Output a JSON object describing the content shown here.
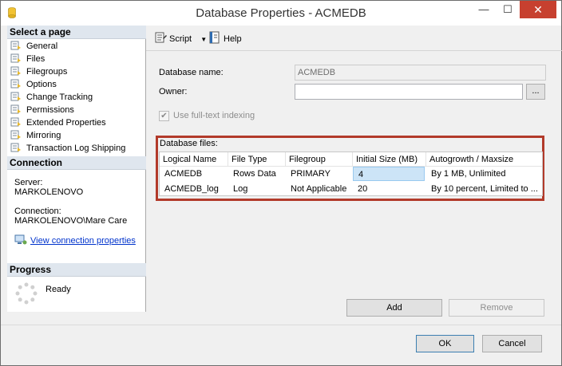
{
  "window": {
    "title": "Database Properties - ACMEDB",
    "minimize": "—",
    "maximize": "☐",
    "close": "✕"
  },
  "select_page": {
    "header": "Select a page",
    "items": [
      {
        "label": "General",
        "icon": "page-icon"
      },
      {
        "label": "Files",
        "icon": "page-icon"
      },
      {
        "label": "Filegroups",
        "icon": "page-icon"
      },
      {
        "label": "Options",
        "icon": "page-icon"
      },
      {
        "label": "Change Tracking",
        "icon": "page-icon"
      },
      {
        "label": "Permissions",
        "icon": "page-icon"
      },
      {
        "label": "Extended Properties",
        "icon": "page-icon"
      },
      {
        "label": "Mirroring",
        "icon": "page-icon"
      },
      {
        "label": "Transaction Log Shipping",
        "icon": "page-icon"
      }
    ]
  },
  "connection": {
    "header": "Connection",
    "server_label": "Server:",
    "server_value": "MARKOLENOVO",
    "connection_label": "Connection:",
    "connection_value": "MARKOLENOVO\\Mare Care",
    "view_link": "View connection properties"
  },
  "progress": {
    "header": "Progress",
    "status": "Ready"
  },
  "toolbar": {
    "script_label": "Script",
    "help_label": "Help"
  },
  "form": {
    "db_name_label": "Database name:",
    "db_name_value": "ACMEDB",
    "owner_label": "Owner:",
    "owner_value": "",
    "browse_label": "...",
    "fulltext_label": "Use full-text indexing",
    "fulltext_checked": true
  },
  "files": {
    "label": "Database files:",
    "columns": [
      "Logical Name",
      "File Type",
      "Filegroup",
      "Initial Size (MB)",
      "Autogrowth / Maxsize"
    ],
    "rows": [
      [
        "ACMEDB",
        "Rows Data",
        "PRIMARY",
        "4",
        "By 1 MB, Unlimited"
      ],
      [
        "ACMEDB_log",
        "Log",
        "Not Applicable",
        "20",
        "By 10 percent, Limited to ..."
      ]
    ]
  },
  "buttons": {
    "add": "Add",
    "remove": "Remove",
    "ok": "OK",
    "cancel": "Cancel"
  },
  "colors": {
    "highlight_border": "#b23a2a",
    "section_header_bg": "#dfe6ee",
    "selected_cell": "#cce4f7",
    "close_button": "#c7402f"
  }
}
